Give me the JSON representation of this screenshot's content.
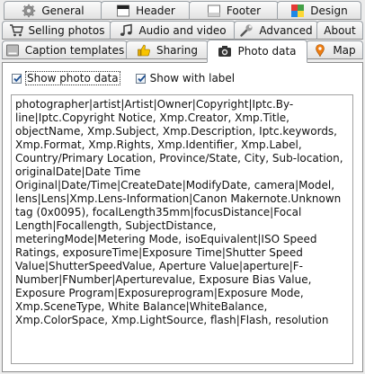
{
  "tabs": {
    "row1": [
      {
        "label": "General",
        "icon": "gear-icon"
      },
      {
        "label": "Header",
        "icon": "header-icon"
      },
      {
        "label": "Footer",
        "icon": "footer-icon"
      },
      {
        "label": "Design",
        "icon": "design-icon"
      }
    ],
    "row2": [
      {
        "label": "Selling photos",
        "icon": "cart-icon"
      },
      {
        "label": "Audio and video",
        "icon": "music-icon"
      },
      {
        "label": "Advanced",
        "icon": "wrench-icon"
      },
      {
        "label": "About",
        "icon": ""
      }
    ],
    "row3": [
      {
        "label": "Caption templates",
        "icon": "caption-icon"
      },
      {
        "label": "Sharing",
        "icon": "thumbs-up-icon"
      },
      {
        "label": "Photo data",
        "icon": "camera-icon"
      },
      {
        "label": "Map",
        "icon": "map-pin-icon"
      }
    ]
  },
  "active_tab": "Photo data",
  "options": {
    "show_photo_data": {
      "label": "Show photo data",
      "checked": true
    },
    "show_with_label": {
      "label": "Show with label",
      "checked": true
    }
  },
  "template_text": "photographer|artist|Artist|Owner|Copyright|Iptc.By-line|Iptc.Copyright Notice, Xmp.Creator, Xmp.Title, objectName, Xmp.Subject, Xmp.Description, Iptc.keywords, Xmp.Format, Xmp.Rights, Xmp.Identifier, Xmp.Label, Country/Primary Location, Province/State, City, Sub-location, originalDate|Date Time Original|Date/Time|CreateDate|ModifyDate, camera|Model, lens|Lens|Xmp.Lens-Information|Canon Makernote.Unknown tag (0x0095), focalLength35mm|focusDistance|Focal Length|Focallength, SubjectDistance, meteringMode|Metering Mode, isoEquivalent|ISO Speed Ratings, exposureTime|Exposure Time|Shutter Speed Value|ShutterSpeedValue, Aperture Value|aperture|F-Number|FNumber|Aperturevalue, Exposure Bias Value, Exposure Program|Exposureprogram|Exposure Mode, Xmp.SceneType, White Balance|WhiteBalance, Xmp.ColorSpace, Xmp.LightSource, flash|Flash, resolution"
}
